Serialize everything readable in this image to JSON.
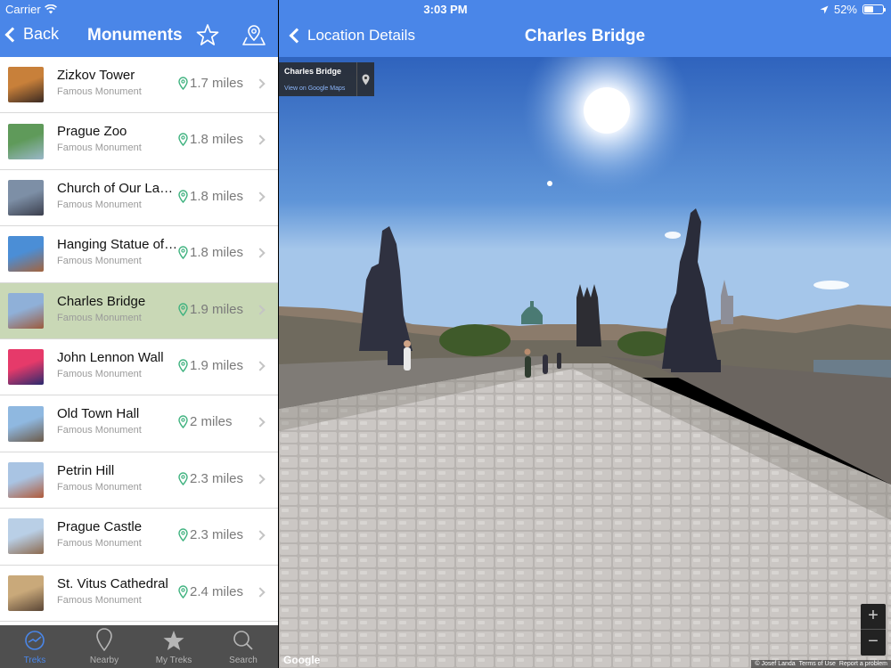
{
  "status": {
    "carrier": "Carrier",
    "time": "3:03 PM",
    "battery": "52%",
    "battery_level": 0.52
  },
  "left_nav": {
    "back_label": "Back",
    "title": "Monuments"
  },
  "list": [
    {
      "name": "Zizkov Tower",
      "sub": "Famous Monument",
      "distance": "1.7 miles",
      "thumb": [
        "#c8803a",
        "#3a2a22"
      ]
    },
    {
      "name": "Prague Zoo",
      "sub": "Famous Monument",
      "distance": "1.8 miles",
      "thumb": [
        "#5f9a5a",
        "#9ab7c8"
      ]
    },
    {
      "name": "Church of Our Lad…",
      "sub": "Famous Monument",
      "distance": "1.8 miles",
      "thumb": [
        "#7d8fa6",
        "#3b3f4d"
      ]
    },
    {
      "name": "Hanging Statue of…",
      "sub": "Famous Monument",
      "distance": "1.8 miles",
      "thumb": [
        "#4b8ed6",
        "#a3643e"
      ]
    },
    {
      "name": "Charles Bridge",
      "sub": "Famous Monument",
      "distance": "1.9 miles",
      "thumb": [
        "#8fb0d8",
        "#9c5a3c"
      ]
    },
    {
      "name": "John Lennon Wall",
      "sub": "Famous Monument",
      "distance": "1.9 miles",
      "thumb": [
        "#e63a6a",
        "#2b2b6e"
      ]
    },
    {
      "name": "Old Town Hall",
      "sub": "Famous Monument",
      "distance": "2 miles",
      "thumb": [
        "#8fb8e0",
        "#6c5a48"
      ]
    },
    {
      "name": "Petrin Hill",
      "sub": "Famous Monument",
      "distance": "2.3 miles",
      "thumb": [
        "#a9c4e3",
        "#b05a3a"
      ]
    },
    {
      "name": "Prague Castle",
      "sub": "Famous Monument",
      "distance": "2.3 miles",
      "thumb": [
        "#b9cfe6",
        "#8c6a4e"
      ]
    },
    {
      "name": "St. Vitus Cathedral",
      "sub": "Famous Monument",
      "distance": "2.4 miles",
      "thumb": [
        "#c9a97a",
        "#5a4636"
      ]
    }
  ],
  "selected_index": 4,
  "tabs": [
    {
      "label": "Treks",
      "icon": "treks-icon"
    },
    {
      "label": "Nearby",
      "icon": "nearby-pin-icon"
    },
    {
      "label": "My Treks",
      "icon": "star-icon"
    },
    {
      "label": "Search",
      "icon": "search-icon"
    }
  ],
  "active_tab": 0,
  "right_nav": {
    "back_label": "Location Details",
    "title": "Charles Bridge"
  },
  "streetview": {
    "place": "Charles Bridge",
    "maps_link": "View on Google Maps",
    "zoom_in": "+",
    "zoom_out": "−",
    "google": "Google",
    "credits": [
      "© Josef Landa",
      "Terms of Use",
      "Report a problem"
    ]
  },
  "colors": {
    "nav_blue": "#4a86e8",
    "selected_row": "#c9d8b6",
    "tabbar": "#4f4f4f",
    "pin_green": "#3fb27f"
  }
}
